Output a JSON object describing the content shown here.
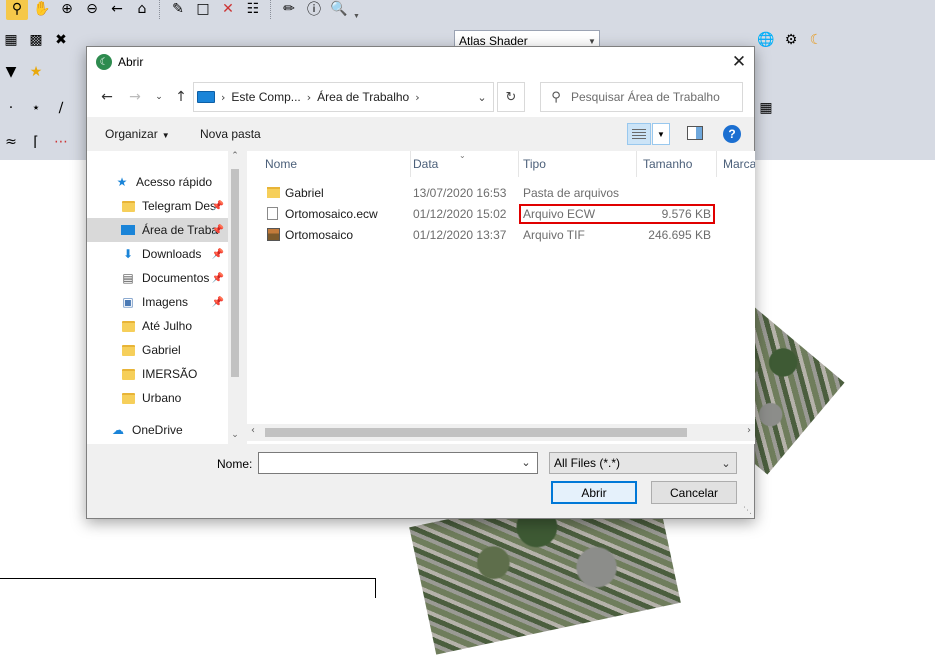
{
  "background_app": {
    "shader_label": "Atlas Shader",
    "toolbar_icons": [
      "zoom-select-icon",
      "pan-icon",
      "zoom-in-icon",
      "zoom-out-icon",
      "back-icon",
      "home-icon",
      "pencil-icon",
      "select-icon",
      "delete-icon",
      "edit-icon",
      "ruler-icon",
      "info-icon",
      "search-doc-icon"
    ]
  },
  "dialog": {
    "title": "Abrir",
    "address": {
      "crumbs": [
        "Este Comp...",
        "Área de Trabalho"
      ]
    },
    "search": {
      "placeholder": "Pesquisar Área de Trabalho"
    },
    "commands": {
      "organize": "Organizar",
      "new_folder": "Nova pasta"
    },
    "nav": {
      "items": [
        {
          "label": "Acesso rápido",
          "icon": "star-icon",
          "pinned": false,
          "selected": false
        },
        {
          "label": "Telegram Des",
          "icon": "folder-icon",
          "pinned": true,
          "selected": false
        },
        {
          "label": "Área de Traba",
          "icon": "desktop-icon",
          "pinned": true,
          "selected": true
        },
        {
          "label": "Downloads",
          "icon": "download-icon",
          "pinned": true,
          "selected": false
        },
        {
          "label": "Documentos",
          "icon": "document-icon",
          "pinned": true,
          "selected": false
        },
        {
          "label": "Imagens",
          "icon": "pictures-icon",
          "pinned": true,
          "selected": false
        },
        {
          "label": "Até Julho",
          "icon": "folder-icon",
          "pinned": false,
          "selected": false
        },
        {
          "label": "Gabriel",
          "icon": "folder-icon",
          "pinned": false,
          "selected": false
        },
        {
          "label": "IMERSÃO",
          "icon": "folder-icon",
          "pinned": false,
          "selected": false
        },
        {
          "label": "Urbano",
          "icon": "folder-icon",
          "pinned": false,
          "selected": false
        },
        {
          "label": "OneDrive",
          "icon": "cloud-icon",
          "pinned": false,
          "selected": false
        }
      ]
    },
    "columns": {
      "name": "Nome",
      "date": "Data",
      "type": "Tipo",
      "size": "Tamanho",
      "tags": "Marca"
    },
    "files": [
      {
        "name": "Gabriel",
        "date": "13/07/2020 16:53",
        "type": "Pasta de arquivos",
        "size": "",
        "icon": "folder-icon"
      },
      {
        "name": "Ortomosaico.ecw",
        "date": "01/12/2020 15:02",
        "type": "Arquivo ECW",
        "size": "9.576 KB",
        "icon": "file-icon"
      },
      {
        "name": "Ortomosaico",
        "date": "01/12/2020 13:37",
        "type": "Arquivo TIF",
        "size": "246.695 KB",
        "icon": "image-file-icon"
      }
    ],
    "filename": {
      "label": "Nome:",
      "value": ""
    },
    "filter": {
      "value": "All Files (*.*)"
    },
    "buttons": {
      "open": "Abrir",
      "cancel": "Cancelar"
    },
    "colors": {
      "highlight": "#e00000",
      "accent": "#0078d7",
      "selected_nav": "#d9d9d9"
    }
  }
}
